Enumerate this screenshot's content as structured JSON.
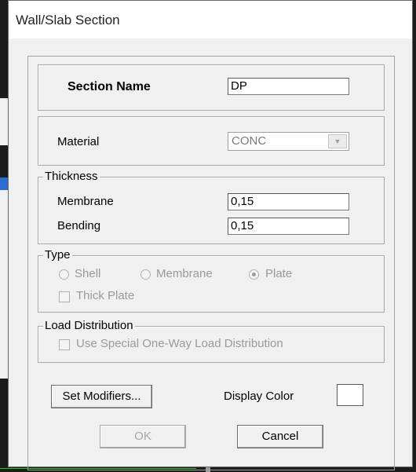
{
  "window": {
    "title": "Wall/Slab Section"
  },
  "section_name": {
    "label": "Section Name",
    "value": "DP"
  },
  "material": {
    "label": "Material",
    "value": "CONC"
  },
  "thickness": {
    "legend": "Thickness",
    "membrane_label": "Membrane",
    "membrane_value": "0,15",
    "bending_label": "Bending",
    "bending_value": "0,15"
  },
  "type": {
    "legend": "Type",
    "options": [
      "Shell",
      "Membrane",
      "Plate"
    ],
    "selected": "Plate",
    "thick_plate_label": "Thick Plate"
  },
  "load_distribution": {
    "legend": "Load Distribution",
    "checkbox_label": "Use Special One-Way Load Distribution"
  },
  "buttons": {
    "set_modifiers": "Set Modifiers...",
    "display_color_label": "Display Color",
    "ok": "OK",
    "cancel": "Cancel"
  },
  "colors": {
    "display_color": "#ffffff",
    "background_app": "#1c1c1c"
  }
}
